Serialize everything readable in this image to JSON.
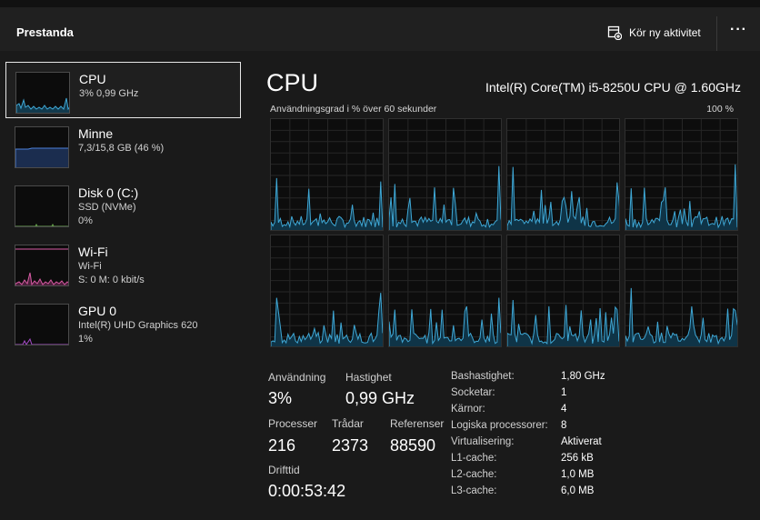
{
  "header": {
    "title": "Prestanda",
    "run_task_label": "Kör ny aktivitet",
    "more_label": "···"
  },
  "sidebar": {
    "items": [
      {
        "name": "CPU",
        "line1": "3% 0,99 GHz",
        "color": "#3fa8d6"
      },
      {
        "name": "Minne",
        "line1": "7,3/15,8 GB (46 %)",
        "color": "#4b80d8"
      },
      {
        "name": "Disk 0 (C:)",
        "line1": "SSD (NVMe)",
        "line2": "0%",
        "color": "#6aa84f"
      },
      {
        "name": "Wi-Fi",
        "line1": "Wi-Fi",
        "line2": "S: 0 M: 0 kbit/s",
        "color": "#d75aa3"
      },
      {
        "name": "GPU 0",
        "line1": "Intel(R) UHD Graphics 620",
        "line2": "1%",
        "color": "#a64cc9"
      }
    ]
  },
  "main": {
    "title": "CPU",
    "model": "Intel(R) Core(TM) i5-8250U CPU @ 1.60GHz",
    "graph_label": "Användningsgrad i % över 60 sekunder",
    "graph_max": "100 %",
    "graph_color": "#3fa8d6"
  },
  "stats": {
    "usage_label": "Användning",
    "usage_value": "3%",
    "speed_label": "Hastighet",
    "speed_value": "0,99 GHz",
    "processes_label": "Processer",
    "processes_value": "216",
    "threads_label": "Trådar",
    "threads_value": "2373",
    "handles_label": "Referenser",
    "handles_value": "88590",
    "uptime_label": "Drifttid",
    "uptime_value": "0:00:53:42"
  },
  "specs": [
    {
      "label": "Bashastighet:",
      "value": "1,80 GHz"
    },
    {
      "label": "Socketar:",
      "value": "1"
    },
    {
      "label": "Kärnor:",
      "value": "4"
    },
    {
      "label": "Logiska processorer:",
      "value": "8"
    },
    {
      "label": "Virtualisering:",
      "value": "Aktiverat"
    },
    {
      "label": "L1-cache:",
      "value": "256 kB"
    },
    {
      "label": "L2-cache:",
      "value": "1,0 MB"
    },
    {
      "label": "L3-cache:",
      "value": "6,0 MB"
    }
  ]
}
